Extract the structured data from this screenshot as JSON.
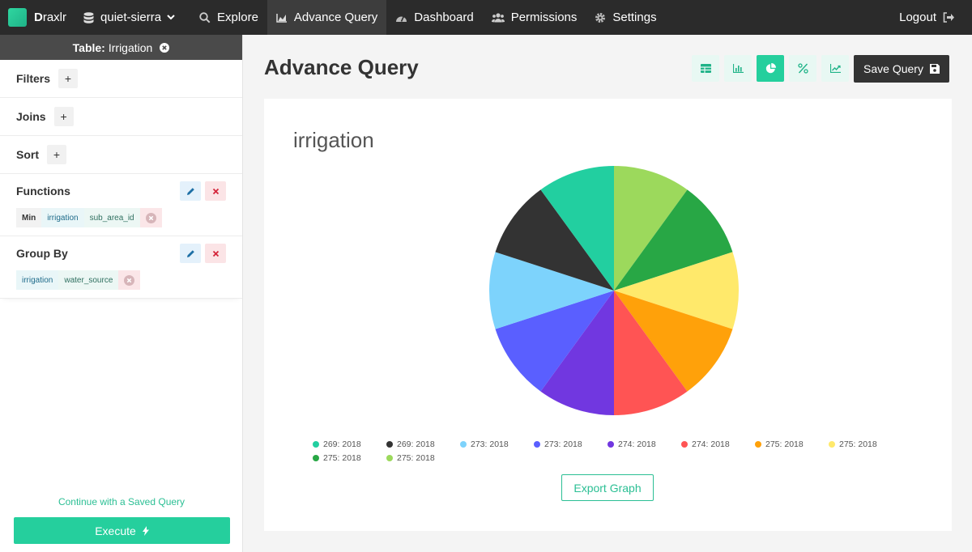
{
  "navbar": {
    "brand_bold": "D",
    "brand_rest": "raxlr",
    "database": "quiet-sierra",
    "items": [
      {
        "label": "Explore",
        "icon": "search-icon"
      },
      {
        "label": "Advance Query",
        "icon": "area-chart-icon"
      },
      {
        "label": "Dashboard",
        "icon": "gauge-icon"
      },
      {
        "label": "Permissions",
        "icon": "users-icon"
      },
      {
        "label": "Settings",
        "icon": "gear-icon"
      }
    ],
    "active_item": "Advance Query",
    "logout": "Logout"
  },
  "sidebar": {
    "table_label": "Table:",
    "table_name": "Irrigation",
    "filters": {
      "title": "Filters",
      "add": "+"
    },
    "joins": {
      "title": "Joins",
      "add": "+"
    },
    "sort": {
      "title": "Sort",
      "add": "+"
    },
    "functions": {
      "title": "Functions",
      "chip": {
        "func": "Min",
        "table": "irrigation",
        "column": "sub_area_id"
      }
    },
    "group_by": {
      "title": "Group By",
      "chip": {
        "table": "irrigation",
        "column": "water_source"
      }
    },
    "saved_query_link": "Continue with a Saved Query",
    "execute": "Execute"
  },
  "main": {
    "title": "Advance Query",
    "viz_buttons": [
      "table-icon",
      "bar-chart-icon",
      "pie-chart-icon",
      "percent-icon",
      "line-chart-icon"
    ],
    "active_viz": "pie-chart-icon",
    "save_query": "Save Query",
    "export_graph": "Export Graph"
  },
  "chart_data": {
    "type": "pie",
    "title": "irrigation",
    "slices": [
      {
        "label": "269: 2018",
        "value": 1,
        "color": "#9cd95c"
      },
      {
        "label": "269: 2018",
        "value": 1,
        "color": "#28a745"
      },
      {
        "label": "273: 2018",
        "value": 1,
        "color": "#ffe96b"
      },
      {
        "label": "273: 2018",
        "value": 1,
        "color": "#ffa10a"
      },
      {
        "label": "274: 2018",
        "value": 1,
        "color": "#ff5454"
      },
      {
        "label": "274: 2018",
        "value": 1,
        "color": "#7137e0"
      },
      {
        "label": "275: 2018",
        "value": 1,
        "color": "#5a5fff"
      },
      {
        "label": "275: 2018",
        "value": 1,
        "color": "#7dd3fc"
      },
      {
        "label": "275: 2018",
        "value": 1,
        "color": "#333333"
      },
      {
        "label": "275: 2018",
        "value": 1,
        "color": "#22cfa0"
      }
    ],
    "legend": [
      {
        "label": "269: 2018",
        "color": "#22cfa0"
      },
      {
        "label": "269: 2018",
        "color": "#333333"
      },
      {
        "label": "273: 2018",
        "color": "#7dd3fc"
      },
      {
        "label": "273: 2018",
        "color": "#5a5fff"
      },
      {
        "label": "274: 2018",
        "color": "#7137e0"
      },
      {
        "label": "274: 2018",
        "color": "#ff5454"
      },
      {
        "label": "275: 2018",
        "color": "#ffa10a"
      },
      {
        "label": "275: 2018",
        "color": "#ffe96b"
      },
      {
        "label": "275: 2018",
        "color": "#28a745"
      },
      {
        "label": "275: 2018",
        "color": "#9cd95c"
      }
    ],
    "legend_position": "bottom"
  }
}
